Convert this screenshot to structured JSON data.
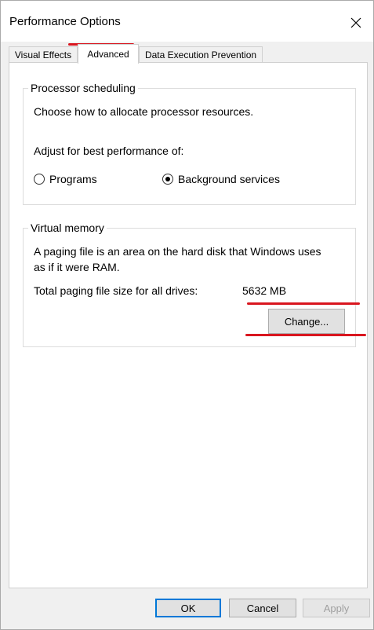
{
  "window": {
    "title": "Performance Options",
    "close_icon": "close-icon"
  },
  "tabs": [
    {
      "label": "Visual Effects",
      "active": false
    },
    {
      "label": "Advanced",
      "active": true
    },
    {
      "label": "Data Execution Prevention",
      "active": false
    }
  ],
  "processor": {
    "group_label": "Processor scheduling",
    "description": "Choose how to allocate processor resources.",
    "adjust_label": "Adjust for best performance of:",
    "options": [
      {
        "label": "Programs",
        "selected": false
      },
      {
        "label": "Background services",
        "selected": true
      }
    ]
  },
  "virtual_memory": {
    "group_label": "Virtual memory",
    "description_line1": "A paging file is an area on the hard disk that Windows uses",
    "description_line2": "as if it were RAM.",
    "total_label": "Total paging file size for all drives:",
    "total_value": "5632 MB",
    "change_button": "Change..."
  },
  "footer": {
    "ok": "OK",
    "cancel": "Cancel",
    "apply": "Apply"
  },
  "annotation_color": "#d9161f"
}
